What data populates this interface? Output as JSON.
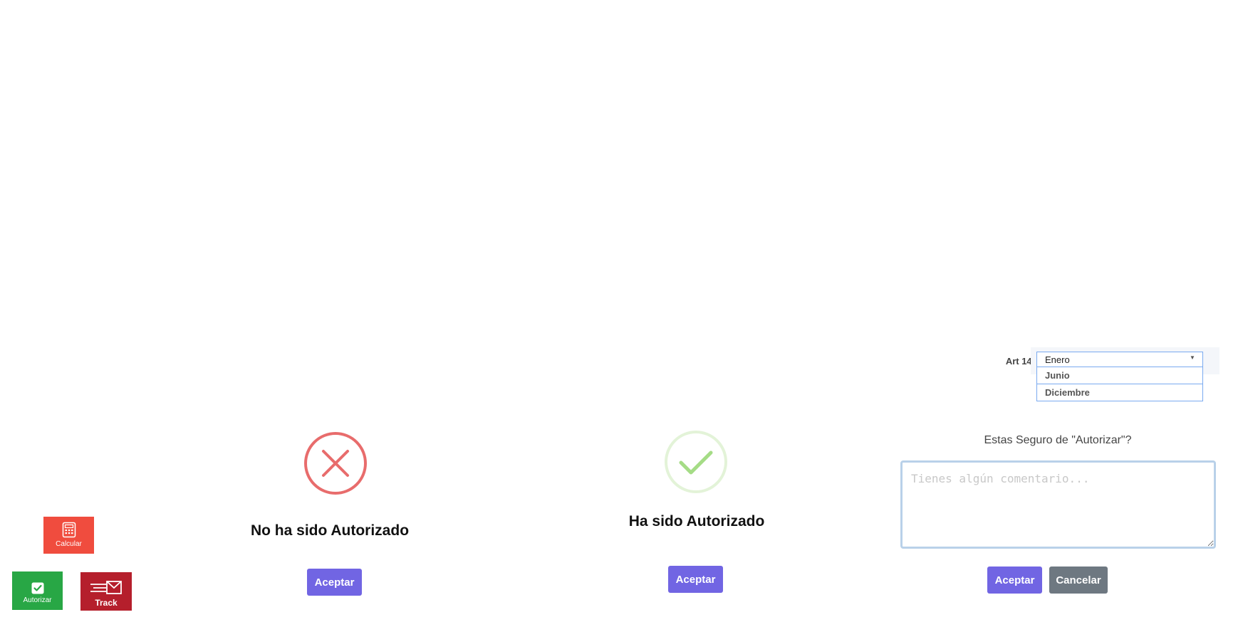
{
  "art14": {
    "label": "Art 14:",
    "selected": "Enero",
    "options": [
      "Junio",
      "Diciembre"
    ]
  },
  "error_dialog": {
    "title": "No ha sido Autorizado",
    "accept_label": "Aceptar",
    "icon": "x-circle-icon",
    "color": "#e86c6c"
  },
  "success_dialog": {
    "title": "Ha sido Autorizado",
    "accept_label": "Aceptar",
    "icon": "check-circle-icon",
    "color": "#a5dc86"
  },
  "confirm_dialog": {
    "question": "Estas Seguro de \"Autorizar\"?",
    "comment_placeholder": "Tienes algún comentario...",
    "accept_label": "Aceptar",
    "cancel_label": "Cancelar"
  },
  "tiles": {
    "calcular": {
      "label": "Calcular",
      "icon": "calculator-icon",
      "color": "#f04c3e"
    },
    "autorizar": {
      "label": "Autorizar",
      "icon": "checkbox-icon",
      "color": "#28a745"
    },
    "track": {
      "label": "Track",
      "icon": "mail-send-icon",
      "color": "#b51f2c"
    }
  },
  "colors": {
    "primary_button": "#7165e3",
    "secondary_button": "#6e7881"
  }
}
